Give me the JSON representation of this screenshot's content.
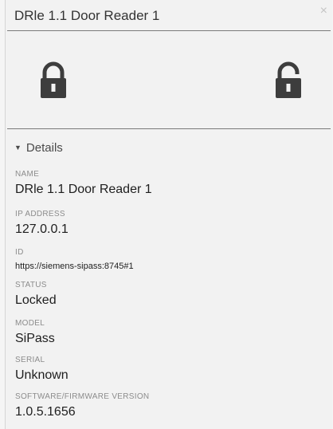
{
  "header": {
    "title": "DRle 1.1 Door Reader 1",
    "close_symbol": "×"
  },
  "actions": {
    "lock_icon": "locked-padlock-icon",
    "unlock_icon": "unlocked-padlock-icon",
    "icon_color": "#3d3d3d"
  },
  "details": {
    "caret": "▼",
    "title": "Details",
    "fields": [
      {
        "label": "NAME",
        "value": "DRle 1.1 Door Reader 1"
      },
      {
        "label": "IP ADDRESS",
        "value": "127.0.0.1"
      },
      {
        "label": "ID",
        "value": "https://siemens-sipass:8745#1"
      },
      {
        "label": "STATUS",
        "value": "Locked"
      },
      {
        "label": "MODEL",
        "value": "SiPass"
      },
      {
        "label": "SERIAL",
        "value": "Unknown"
      },
      {
        "label": "SOFTWARE/FIRMWARE VERSION",
        "value": "1.0.5.1656"
      }
    ]
  }
}
